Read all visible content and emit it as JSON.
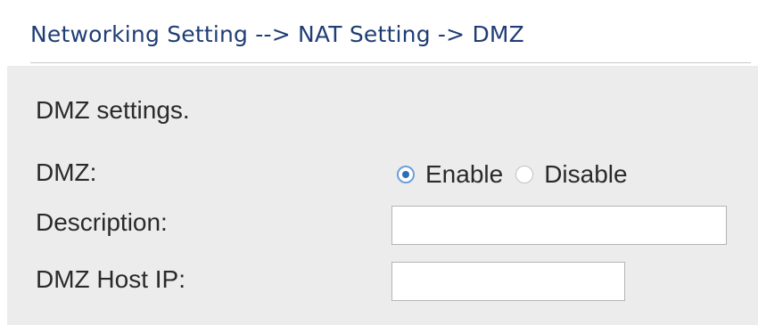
{
  "header": {
    "breadcrumb": "Networking Setting --> NAT Setting -> DMZ"
  },
  "panel": {
    "heading": "DMZ settings.",
    "dmz": {
      "label": "DMZ:",
      "options": [
        {
          "label": "Enable",
          "selected": true
        },
        {
          "label": "Disable",
          "selected": false
        }
      ]
    },
    "description": {
      "label": "Description:",
      "value": ""
    },
    "host_ip": {
      "label": "DMZ Host IP:",
      "value": ""
    }
  },
  "colors": {
    "breadcrumb": "#1f3e74",
    "panel_background": "#ececec",
    "radio_accent": "#2c6fb8"
  }
}
